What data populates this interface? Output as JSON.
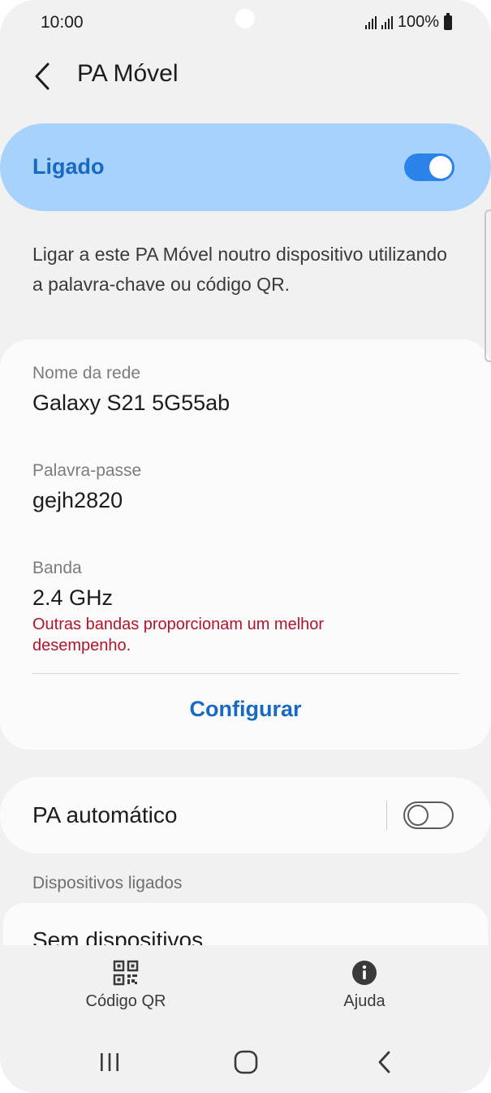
{
  "status_bar": {
    "time": "10:00",
    "battery": "100%"
  },
  "header": {
    "title": "PA Móvel"
  },
  "master_switch": {
    "label": "Ligado",
    "state": "on"
  },
  "description": "Ligar a este PA Móvel noutro dispositivo utilizando a palavra-chave ou código QR.",
  "network": {
    "name_label": "Nome da rede",
    "name_value": "Galaxy S21 5G55ab",
    "password_label": "Palavra-passe",
    "password_value": "gejh2820",
    "band_label": "Banda",
    "band_value": "2.4 GHz",
    "band_warning": "Outras bandas proporcionam um melhor desempenho.",
    "configure_label": "Configurar"
  },
  "auto_hotspot": {
    "label": "PA automático",
    "state": "off"
  },
  "connected_devices": {
    "section_title": "Dispositivos ligados",
    "empty_text": "Sem dispositivos"
  },
  "bottom_bar": {
    "qr_label": "Código QR",
    "help_label": "Ajuda"
  },
  "colors": {
    "accent": "#1769c2",
    "toggle_on": "#2b82e8",
    "master_bg": "#a7d2fb",
    "warning": "#b0152b"
  },
  "icons": [
    "back-arrow-icon",
    "qr-code-icon",
    "info-icon",
    "recents-icon",
    "home-icon",
    "back-nav-icon"
  ]
}
